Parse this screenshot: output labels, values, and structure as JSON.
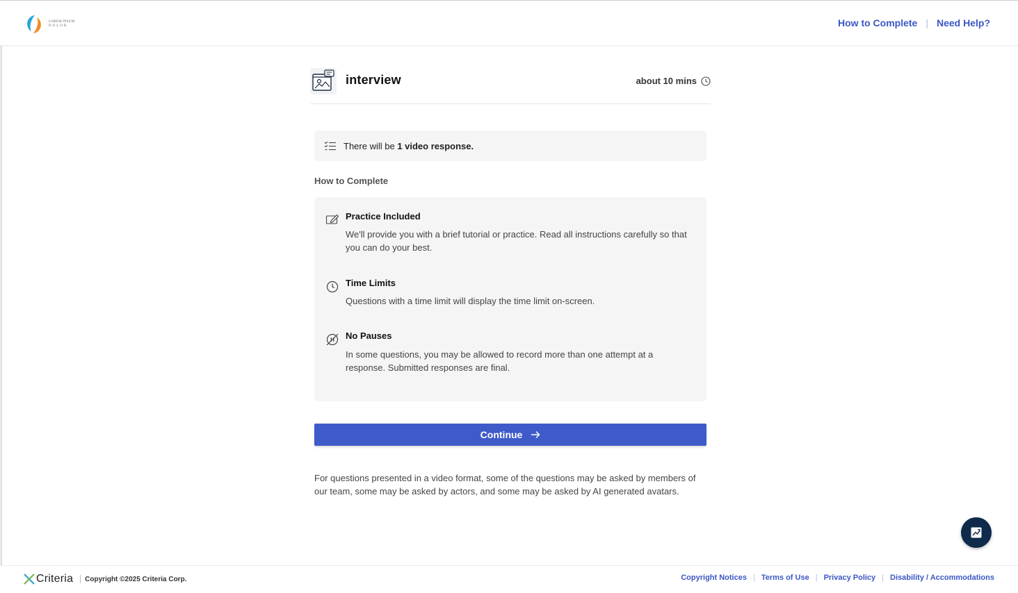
{
  "header": {
    "logo_text_line1": "LOREM IPSUM",
    "logo_text_line2": "DOLOR",
    "links": [
      "How to Complete",
      "Need Help?"
    ]
  },
  "assessment": {
    "title": "interview",
    "duration": "about 10 mins",
    "info_prefix": "There will be ",
    "info_bold": "1 video response."
  },
  "how_to": {
    "heading": "How to Complete",
    "items": [
      {
        "icon": "edit-icon",
        "title": "Practice Included",
        "desc": "We'll provide you with a brief tutorial or practice. Read all instructions carefully so that you can do your best."
      },
      {
        "icon": "clock-icon",
        "title": "Time Limits",
        "desc": "Questions with a time limit will display the time limit on-screen."
      },
      {
        "icon": "no-pause-icon",
        "title": "No Pauses",
        "desc": "In some questions, you may be allowed to record more than one attempt at a response. Submitted responses are final."
      }
    ]
  },
  "continue_label": "Continue",
  "disclaimer": "For questions presented in a video format, some of the questions may be asked by members of our team, some may be asked by actors, and some may be asked by AI generated avatars.",
  "footer": {
    "brand": "Criteria",
    "copyright": "Copyright ©2025 Criteria Corp.",
    "links": [
      "Copyright Notices",
      "Terms of Use",
      "Privacy Policy",
      "Disability / Accommodations"
    ]
  },
  "colors": {
    "accent": "#3f5bc9",
    "link": "#3b57c4",
    "chat": "#0f2a4a"
  }
}
